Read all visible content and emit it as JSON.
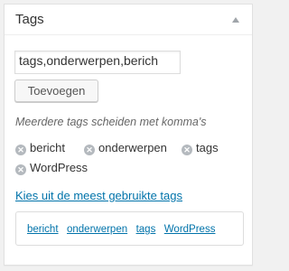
{
  "panel": {
    "title": "Tags",
    "toggle_icon": "triangle-up-icon"
  },
  "input": {
    "value": "tags,onderwerpen,berich",
    "placeholder": ""
  },
  "add_button": {
    "label": "Toevoegen"
  },
  "hint": "Meerdere tags scheiden met komma's",
  "tags": [
    {
      "label": "bericht",
      "icon": "remove-icon"
    },
    {
      "label": "onderwerpen",
      "icon": "remove-icon"
    },
    {
      "label": "tags",
      "icon": "remove-icon"
    },
    {
      "label": "WordPress",
      "icon": "remove-icon"
    }
  ],
  "popular": {
    "link_label": "Kies uit de meest gebruikte tags",
    "cloud": [
      "bericht",
      "onderwerpen",
      "tags",
      "WordPress"
    ]
  },
  "colors": {
    "link": "#0073aa",
    "remove_icon": "#b4b9be",
    "page_bg": "#f1f1f1"
  }
}
